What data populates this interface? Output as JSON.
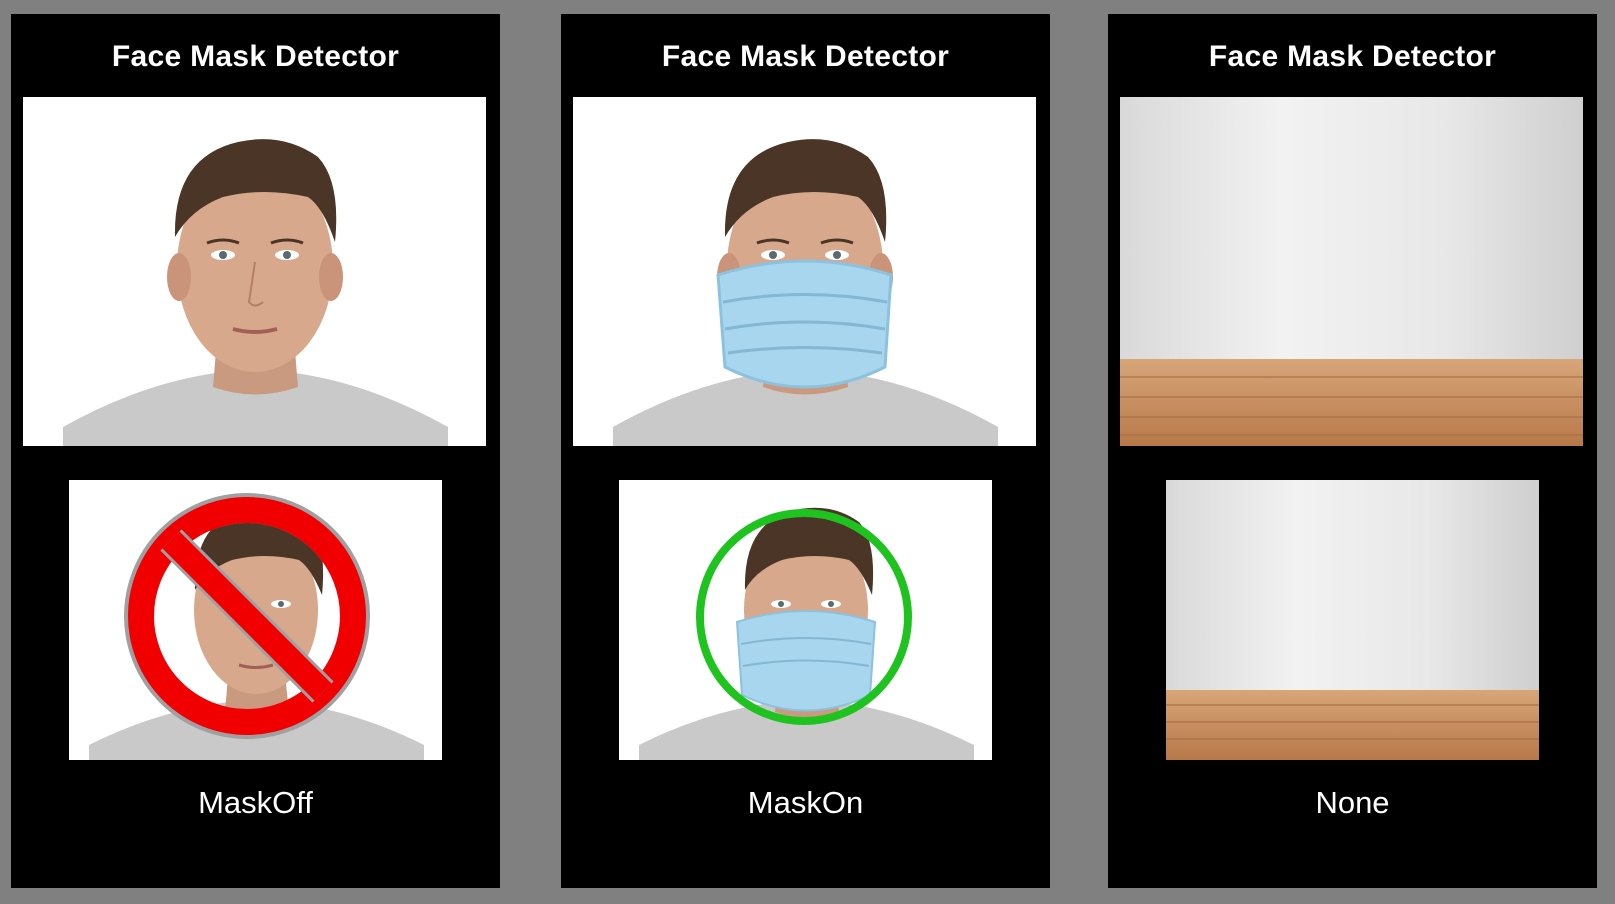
{
  "colors": {
    "page_bg": "#808080",
    "panel_bg": "#000000",
    "title_text": "#ffffff",
    "no_sign_red": "#f00000",
    "ok_ring_green": "#1fc31f",
    "mask_blue": "#a7d6ee"
  },
  "panels": [
    {
      "title": "Face Mask Detector",
      "result_label": "MaskOff",
      "input_scene": "person-face-photo",
      "result_overlay": "prohibited-sign-icon"
    },
    {
      "title": "Face Mask Detector",
      "result_label": "MaskOn",
      "input_scene": "person-with-mask-photo",
      "result_overlay": "green-circle-icon"
    },
    {
      "title": "Face Mask Detector",
      "result_label": "None",
      "input_scene": "empty-room-photo",
      "result_overlay": "none"
    }
  ]
}
